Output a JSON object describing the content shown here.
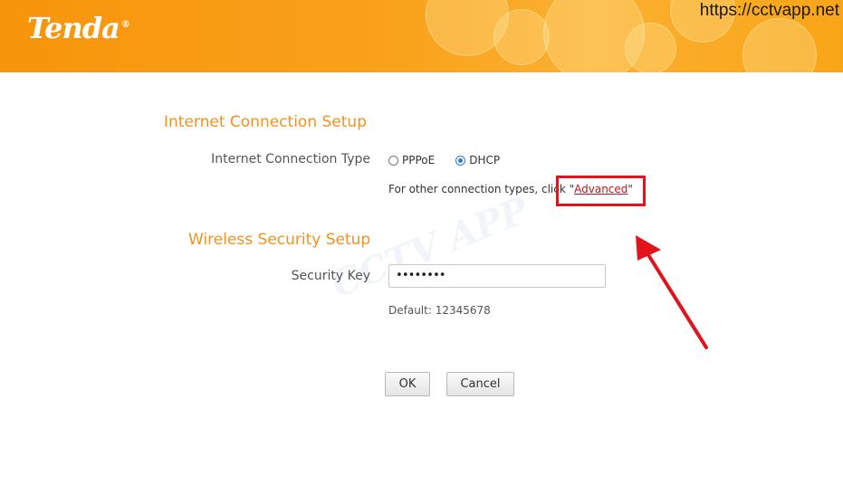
{
  "header": {
    "logo": "Tenda",
    "logo_mark": "®",
    "watermark_url": "https://cctvapp.net"
  },
  "internet": {
    "title": "Internet Connection Setup",
    "type_label": "Internet Connection Type",
    "options": [
      {
        "label": "PPPoE",
        "checked": false
      },
      {
        "label": "DHCP",
        "checked": true
      }
    ],
    "hint_prefix": "For other connection types, click \"",
    "advanced_link": "Advanced",
    "hint_suffix": "\""
  },
  "wireless": {
    "title": "Wireless Security Setup",
    "key_label": "Security Key",
    "key_value": "••••••••",
    "default_text": "Default: 12345678"
  },
  "buttons": {
    "ok": "OK",
    "cancel": "Cancel"
  },
  "overlay": {
    "watermark": "CCTV APP",
    "annotation_color": "#e3131c"
  }
}
